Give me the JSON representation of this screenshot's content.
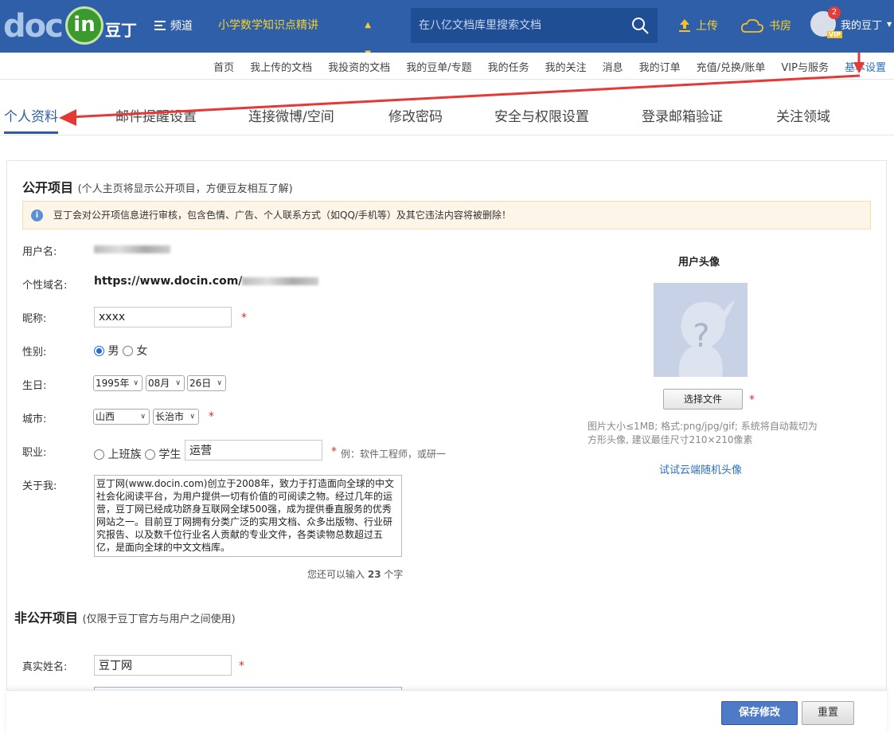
{
  "header": {
    "logo_doc": "doc",
    "logo_in": "in",
    "logo_cn": "豆丁",
    "menu_label": "频道",
    "channel": "小学数学知识点精讲",
    "search_placeholder": "在八亿文档库里搜索文档",
    "upload_label": "上传",
    "shelf_label": "书房",
    "badge_count": "2",
    "vip_label": "VIP",
    "mine_label": "我的豆丁"
  },
  "subnav": {
    "items": [
      "首页",
      "我上传的文档",
      "我投资的文档",
      "我的豆单/专题",
      "我的任务",
      "我的关注",
      "消息",
      "我的订单",
      "充值/兑换/账单",
      "VIP与服务",
      "基本设置"
    ]
  },
  "tabs": [
    "个人资料",
    "邮件提醒设置",
    "连接微博/空间",
    "修改密码",
    "安全与权限设置",
    "登录邮箱验证",
    "关注领域"
  ],
  "public": {
    "title": "公开项目",
    "subtitle": "(个人主页将显示公开项目，方便豆友相互了解)",
    "notice": "豆丁会对公开项信息进行审核，包含色情、广告、个人联系方式（如QQ/手机等）及其它违法内容将被删除！"
  },
  "form": {
    "username_label": "用户名:",
    "domain_label": "个性域名:",
    "domain_value": "https://www.docin.com/",
    "nickname_label": "昵称:",
    "nickname_value": "xxxx",
    "gender_label": "性别:",
    "gender_male": "男",
    "gender_female": "女",
    "birthday_label": "生日:",
    "birth_year": "1995年",
    "birth_month": "08月",
    "birth_day": "26日",
    "city_label": "城市:",
    "province": "山西",
    "city": "长治市",
    "job_label": "职业:",
    "job_office": "上班族",
    "job_student": "学生",
    "job_value": "运营",
    "job_hint": "例：软件工程师，或研一",
    "about_label": "关于我:",
    "about_value": "豆丁网(www.docin.com)创立于2008年，致力于打造面向全球的中文社会化阅读平台，为用户提供一切有价值的可阅读之物。经过几年的运营，豆丁网已经成功跻身互联网全球500强，成为提供垂直服务的优秀网站之一。目前豆丁网拥有分类广泛的实用文档、众多出版物、行业研究报告、以及数千位行业名人贡献的专业文件，各类读物总数超过五亿，是面向全球的中文文档库。",
    "remain_prefix": "您还可以输入",
    "remain_count": "23",
    "remain_suffix": "个字",
    "required_mark": "*"
  },
  "avatar": {
    "title": "用户头像",
    "choose_label": "选择文件",
    "tip": "图片大小≤1MB; 格式:png/jpg/gif; 系统将自动裁切为方形头像, 建议最佳尺寸210×210像素",
    "random_link": "试试云端随机头像"
  },
  "private": {
    "title": "非公开项目",
    "subtitle": "(仅限于豆丁官方与用户之间使用)",
    "realname_label": "真实姓名:",
    "realname_value": "豆丁网"
  },
  "footer": {
    "save_label": "保存修改",
    "reset_label": "重置"
  },
  "colors": {
    "header_bg": "#2f5fa8",
    "accent": "#2b5ea6",
    "annotation_red": "#e53935"
  }
}
